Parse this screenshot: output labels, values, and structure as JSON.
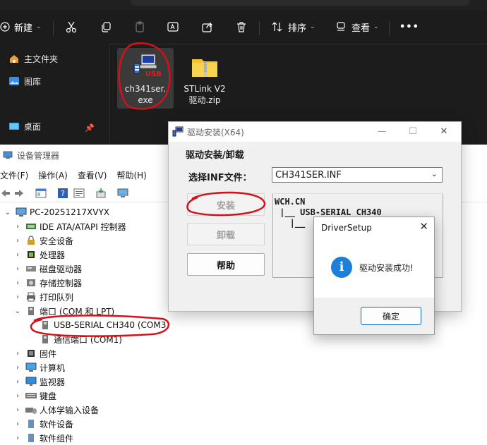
{
  "explorer": {
    "toolbar": {
      "new_label": "新建",
      "sort_label": "排序",
      "view_label": "查看",
      "more_label": "•••"
    },
    "nav": {
      "items": [
        {
          "label": "主文件夹",
          "icon": "home-icon"
        },
        {
          "label": "图库",
          "icon": "gallery-icon"
        },
        {
          "label": "桌面",
          "icon": "desktop-icon"
        }
      ]
    },
    "files": [
      {
        "name_line1": "ch341ser.",
        "name_line2": "exe",
        "icon": "installer-icon",
        "badge": "USB"
      },
      {
        "name_line1": "STLink V2",
        "name_line2": "驱动.zip",
        "icon": "zip-folder-icon"
      }
    ]
  },
  "device_manager": {
    "title": "设备管理器",
    "menu": [
      "文件(F)",
      "操作(A)",
      "查看(V)",
      "帮助(H)"
    ],
    "root": "PC-20251217XVYX",
    "tree": [
      {
        "label": "IDE ATA/ATAPI 控制器",
        "expanded": false
      },
      {
        "label": "安全设备",
        "expanded": false
      },
      {
        "label": "处理器",
        "expanded": false
      },
      {
        "label": "磁盘驱动器",
        "expanded": false
      },
      {
        "label": "存储控制器",
        "expanded": false
      },
      {
        "label": "打印队列",
        "expanded": false
      },
      {
        "label": "端口 (COM 和 LPT)",
        "expanded": true
      },
      {
        "label": "USB-SERIAL CH340 (COM3)",
        "child": true
      },
      {
        "label": "通信端口 (COM1)",
        "child": true
      },
      {
        "label": "固件",
        "expanded": false
      },
      {
        "label": "计算机",
        "expanded": false
      },
      {
        "label": "监视器",
        "expanded": false
      },
      {
        "label": "键盘",
        "expanded": false
      },
      {
        "label": "人体学输入设备",
        "expanded": false
      },
      {
        "label": "软件设备",
        "expanded": false
      },
      {
        "label": "软件组件",
        "expanded": false
      }
    ]
  },
  "driver_window": {
    "title": "驱动安装(X64)",
    "heading": "驱动安装/卸载",
    "inf_label": "选择INF文件：",
    "inf_value": "CH341SER.INF",
    "install_label": "安装",
    "uninstall_label": "卸载",
    "help_label": "帮助",
    "tree_lines": [
      "WCH.CN",
      " |__ USB-SERIAL CH340",
      "   |__"
    ]
  },
  "dialog": {
    "title": "DriverSetup",
    "message": "驱动安装成功!",
    "ok_label": "确定",
    "close_label": "✕"
  },
  "colors": {
    "explorer_bg": "#1c1c1c",
    "annotation_red": "#d4111b",
    "info_blue": "#1e7fd8",
    "dialog_ok_border": "#0067c0"
  }
}
